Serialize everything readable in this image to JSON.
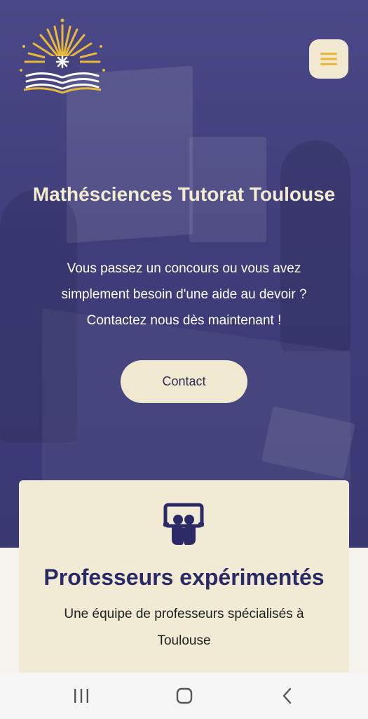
{
  "brand": {
    "logo_icon": "sunburst-open-book-icon"
  },
  "header": {
    "menu_icon": "hamburger-menu-icon"
  },
  "hero": {
    "title": "Mathésciences Tutorat Toulouse",
    "text_line1": "Vous passez un concours ou vous avez",
    "text_line2": "simplement besoin d'une aide au devoir ?",
    "text_line3": "Contactez nous dès maintenant !",
    "contact_label": "Contact"
  },
  "feature_card": {
    "icon": "teacher-presentation-icon",
    "title": "Professeurs expérimentés",
    "text_line1": "Une équipe de professeurs spécialisés à",
    "text_line2": "Toulouse"
  },
  "system_nav": {
    "recents_icon": "recent-apps-icon",
    "home_icon": "home-icon",
    "back_icon": "back-icon"
  },
  "colors": {
    "hero_bg": "#3f3d7a",
    "accent_cream": "#f1e9cf",
    "accent_gold": "#e8b83a",
    "title_navy": "#2b2a66"
  }
}
